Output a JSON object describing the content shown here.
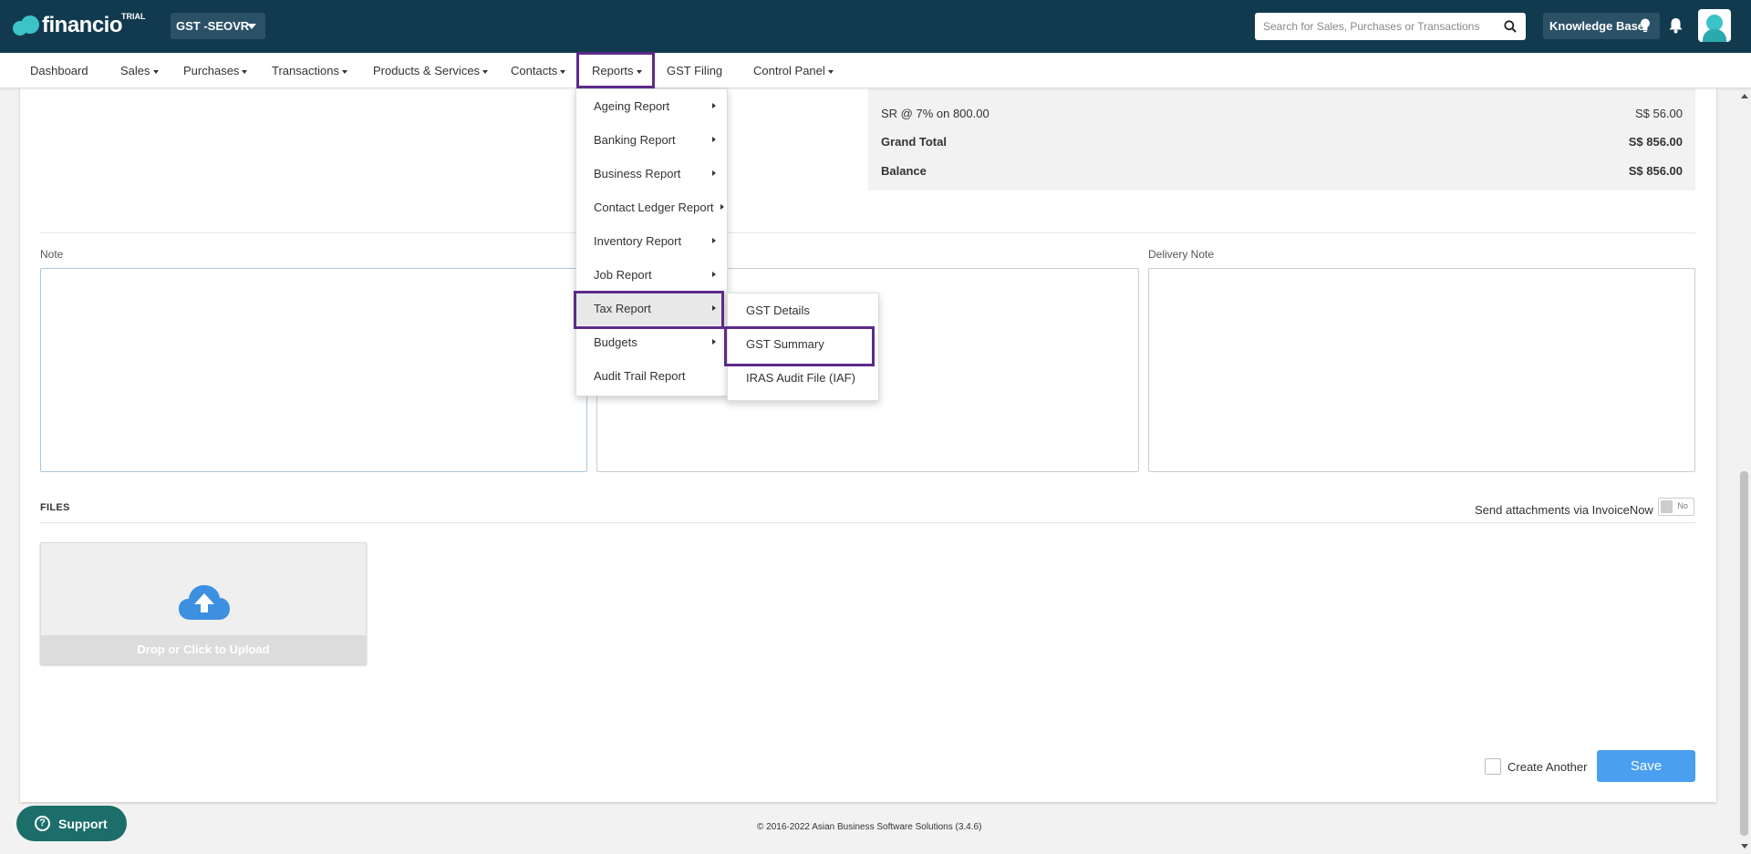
{
  "app": {
    "logo_text": "financio",
    "trial_badge": "TRIAL",
    "org_name": "GST -SEOVR"
  },
  "header": {
    "search_placeholder": "Search for Sales, Purchases or Transactions",
    "knowledge_base": "Knowledge Base"
  },
  "nav": {
    "items": [
      {
        "label": "Dashboard",
        "dropdown": false
      },
      {
        "label": "Sales",
        "dropdown": true
      },
      {
        "label": "Purchases",
        "dropdown": true
      },
      {
        "label": "Transactions",
        "dropdown": true
      },
      {
        "label": "Products & Services",
        "dropdown": true
      },
      {
        "label": "Contacts",
        "dropdown": true
      },
      {
        "label": "Reports",
        "dropdown": true
      },
      {
        "label": "GST Filing",
        "dropdown": false
      },
      {
        "label": "Control Panel",
        "dropdown": true
      }
    ]
  },
  "reports_menu": {
    "items": [
      {
        "label": "Ageing Report",
        "has_submenu": true
      },
      {
        "label": "Banking Report",
        "has_submenu": true
      },
      {
        "label": "Business Report",
        "has_submenu": true
      },
      {
        "label": "Contact Ledger Report",
        "has_submenu": true
      },
      {
        "label": "Inventory Report",
        "has_submenu": true
      },
      {
        "label": "Job Report",
        "has_submenu": true
      },
      {
        "label": "Tax Report",
        "has_submenu": true
      },
      {
        "label": "Budgets",
        "has_submenu": true
      },
      {
        "label": "Audit Trail Report",
        "has_submenu": false
      }
    ],
    "tax_submenu": [
      {
        "label": "GST Details"
      },
      {
        "label": "GST Summary"
      },
      {
        "label": "IRAS Audit File (IAF)"
      }
    ]
  },
  "totals": {
    "tax_line": {
      "label": "SR @ 7% on 800.00",
      "value": "S$ 56.00"
    },
    "grand_total": {
      "label": "Grand Total",
      "value": "S$ 856.00"
    },
    "balance": {
      "label": "Balance",
      "value": "S$ 856.00"
    }
  },
  "form": {
    "note_label": "Note",
    "delivery_note_label": "Delivery Note",
    "files_label": "FILES",
    "send_attachments_label": "Send attachments via InvoiceNow",
    "send_attachments_toggle": "No",
    "upload_label": "Drop or Click to Upload",
    "create_another_label": "Create Another",
    "save_label": "Save"
  },
  "footer": {
    "support_label": "Support",
    "copyright": "© 2016-2022 Asian Business Software Solutions (3.4.6)"
  },
  "colors": {
    "header_bg": "#123a4f",
    "accent_teal": "#3cc3c7",
    "highlight_border": "#5c2b8a",
    "save_button": "#4a9ff0",
    "upload_cloud": "#3d8fe0",
    "support_button": "#1c6e6a"
  }
}
